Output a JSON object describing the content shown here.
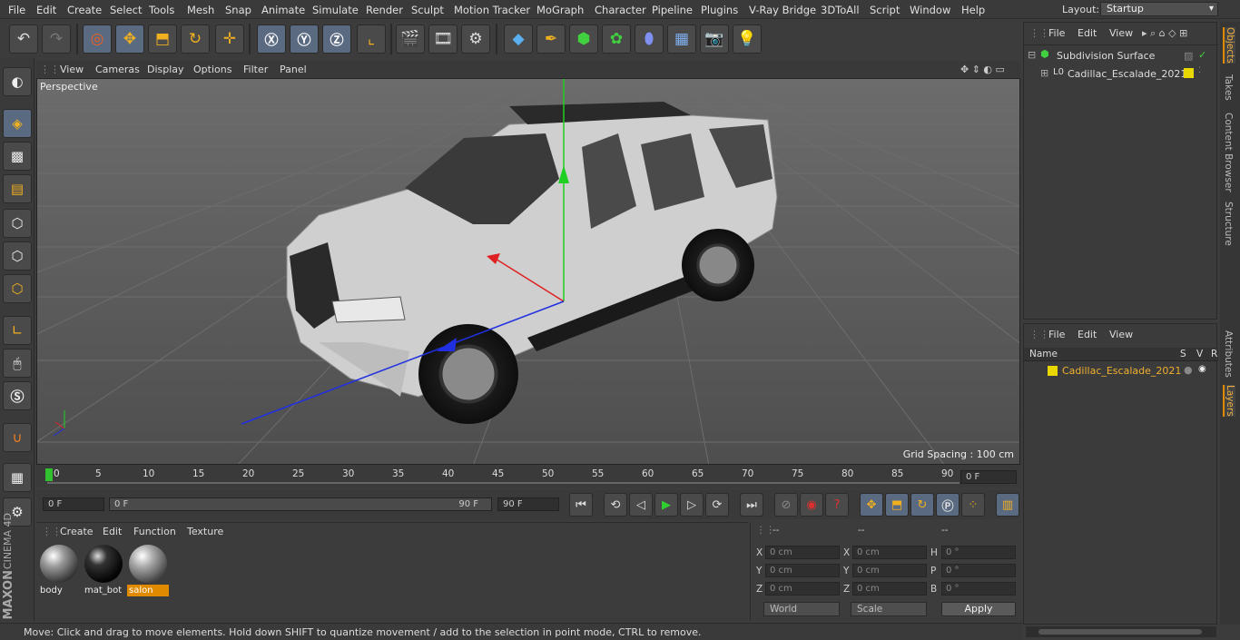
{
  "menubar": {
    "items": [
      "File",
      "Edit",
      "Create",
      "Select",
      "Tools",
      "Mesh",
      "Snap",
      "Animate",
      "Simulate",
      "Render",
      "Sculpt",
      "Motion Tracker",
      "MoGraph",
      "Character",
      "Pipeline",
      "Plugins",
      "V-Ray Bridge",
      "3DToAll",
      "Script",
      "Window",
      "Help"
    ],
    "layout_label": "Layout:",
    "layout_value": "Startup"
  },
  "viewport": {
    "menu": [
      "View",
      "Cameras",
      "Display",
      "Options",
      "Filter",
      "Panel"
    ],
    "label": "Perspective",
    "grid_spacing": "Grid Spacing : 100 cm"
  },
  "timeline": {
    "ticks": [
      "0",
      "5",
      "10",
      "15",
      "20",
      "25",
      "30",
      "35",
      "40",
      "45",
      "50",
      "55",
      "60",
      "65",
      "70",
      "75",
      "80",
      "85",
      "90"
    ],
    "current_frame": "0 F",
    "start": "0 F",
    "range_start": "0 F",
    "range_end": "90 F",
    "end": "90 F"
  },
  "materials": {
    "menu": [
      "Create",
      "Edit",
      "Function",
      "Texture"
    ],
    "items": [
      {
        "name": "body",
        "style": "body"
      },
      {
        "name": "mat_bot",
        "style": "dark"
      },
      {
        "name": "salon",
        "style": "salon",
        "selected": true
      }
    ]
  },
  "attributes": {
    "header": [
      "--",
      "--",
      "--"
    ],
    "rows": [
      {
        "l1": "X",
        "v1": "0 cm",
        "l2": "X",
        "v2": "0 cm",
        "l3": "H",
        "v3": "0 °"
      },
      {
        "l1": "Y",
        "v1": "0 cm",
        "l2": "Y",
        "v2": "0 cm",
        "l3": "P",
        "v3": "0 °"
      },
      {
        "l1": "Z",
        "v1": "0 cm",
        "l2": "Z",
        "v2": "0 cm",
        "l3": "B",
        "v3": "0 °"
      }
    ],
    "world": "World",
    "scale": "Scale",
    "apply": "Apply"
  },
  "objects": {
    "menu": [
      "File",
      "Edit",
      "View"
    ],
    "items": [
      "Subdivision Surface",
      "Cadillac_Escalade_2021"
    ]
  },
  "layers": {
    "menu": [
      "File",
      "Edit",
      "View"
    ],
    "col_name": "Name",
    "col_s": "S",
    "col_v": "V",
    "col_r": "R",
    "items": [
      "Cadillac_Escalade_2021"
    ]
  },
  "side_tabs": [
    "Objects",
    "Takes",
    "Content Browser",
    "Structure",
    "Attributes",
    "Layers"
  ],
  "status": "Move: Click and drag to move elements. Hold down SHIFT to quantize movement / add to the selection in point mode, CTRL to remove.",
  "brand": {
    "line1": "MAXON",
    "line2": "CINEMA 4D"
  },
  "colors": {
    "accent": "#e08a00",
    "layer_yellow": "#e8d800",
    "axis_x": "#e02020",
    "axis_y": "#20d020",
    "axis_z": "#2030e0"
  }
}
